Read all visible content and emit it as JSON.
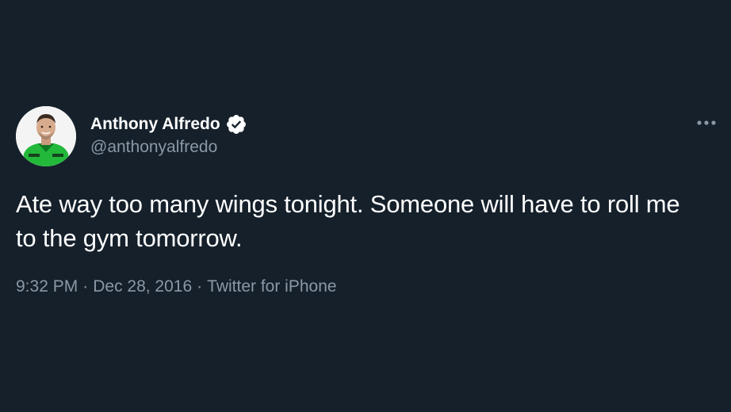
{
  "tweet": {
    "author": {
      "display_name": "Anthony Alfredo",
      "handle": "@anthonyalfredo",
      "verified": true,
      "avatar_icon": "driver-portrait"
    },
    "text": "Ate way too many wings tonight. Someone will have to roll me to the gym tomorrow.",
    "meta": {
      "time": "9:32 PM",
      "date": "Dec 28, 2016",
      "source": "Twitter for iPhone",
      "separator": "·"
    },
    "more_icon": "more-horizontal-icon"
  },
  "colors": {
    "background": "#15202b",
    "primary_text": "#ffffff",
    "secondary_text": "#8b98a5",
    "verified_badge": "#ffffff",
    "avatar_jersey": "#2ecc40"
  }
}
